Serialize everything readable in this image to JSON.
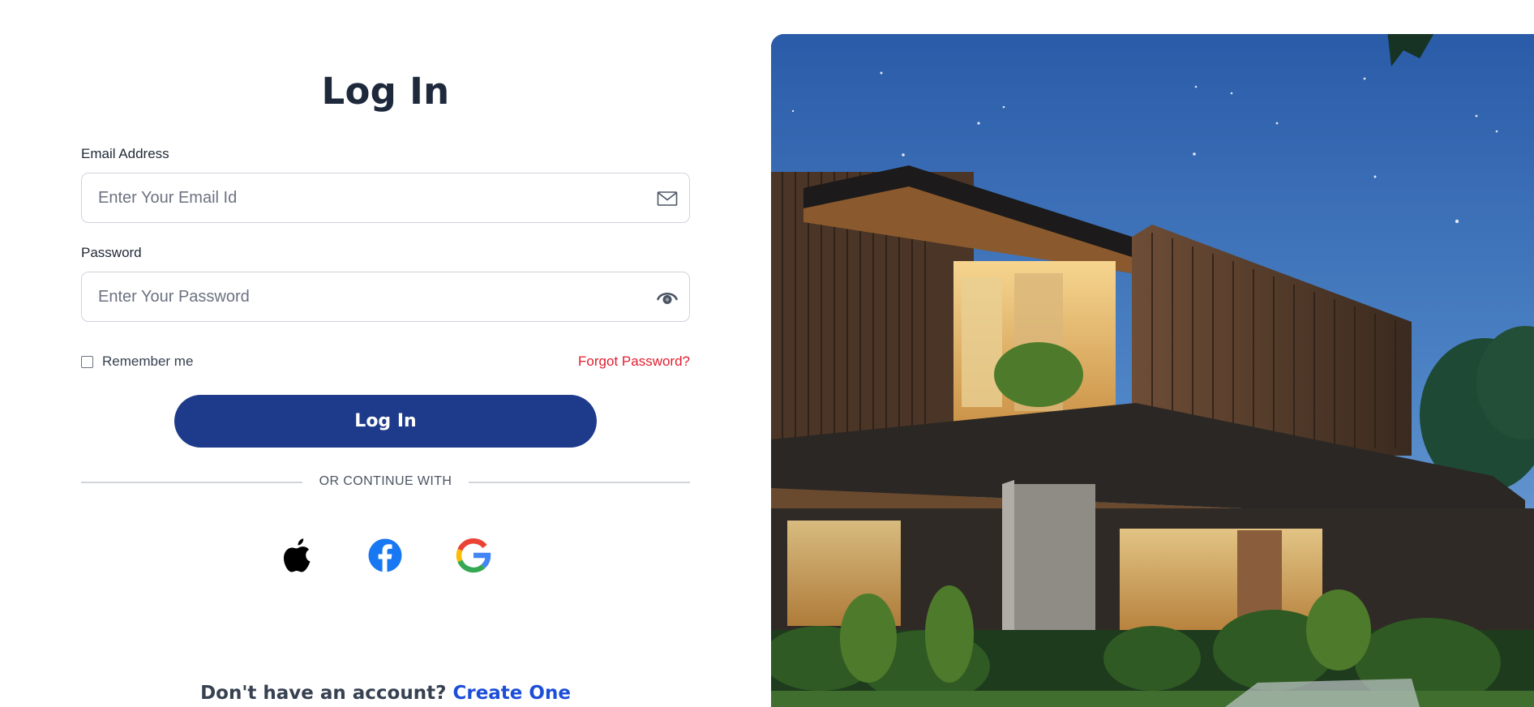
{
  "login": {
    "title": "Log In",
    "email_label": "Email Address",
    "email_placeholder": "Enter Your Email Id",
    "email_value": "",
    "password_label": "Password",
    "password_placeholder": "Enter Your Password",
    "password_value": "",
    "remember_label": "Remember me",
    "remember_checked": false,
    "forgot_label": "Forgot Password?",
    "login_button_label": "Log In",
    "divider_text": "OR CONTINUE WITH",
    "social": [
      {
        "name": "apple",
        "icon": "apple-icon"
      },
      {
        "name": "facebook",
        "icon": "facebook-icon"
      },
      {
        "name": "google",
        "icon": "google-icon"
      }
    ],
    "signup_prompt": "Don't have an account?",
    "signup_link": "Create One"
  },
  "icons": {
    "email": "mail-icon",
    "password": "eye-icon"
  },
  "colors": {
    "primary": "#1e3a8a",
    "link": "#1d4ed8",
    "danger": "#e11d2e",
    "facebook": "#1877f2"
  }
}
